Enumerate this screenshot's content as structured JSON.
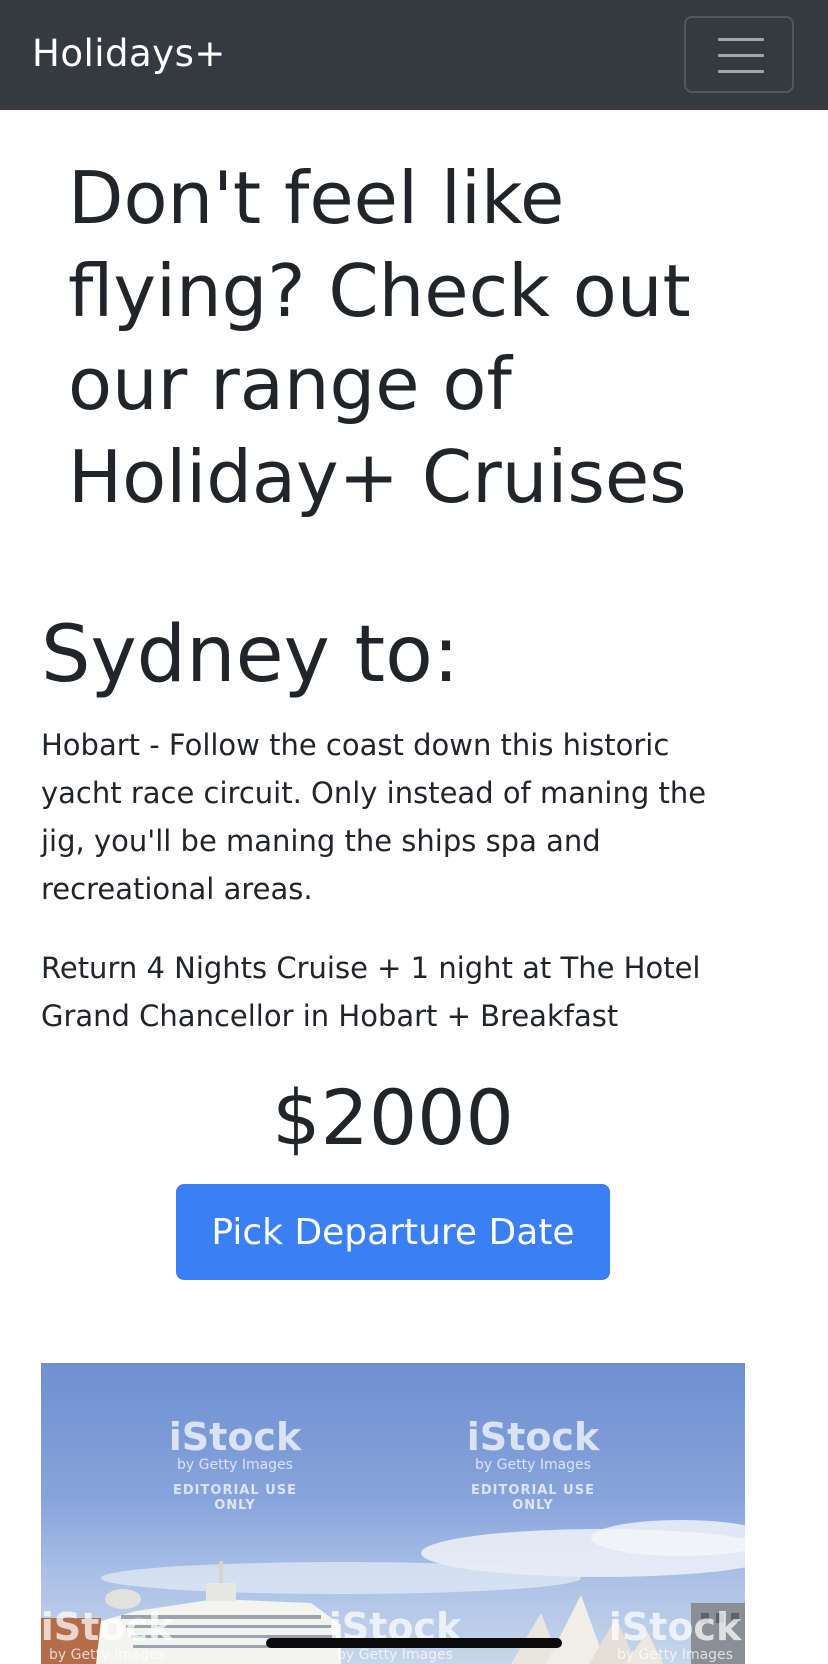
{
  "navbar": {
    "brand": "Holidays+",
    "toggle_icon": "hamburger-menu-icon"
  },
  "hero": {
    "heading": "Don't feel like flying? Check out our range of Holiday+ Cruises"
  },
  "cruise": {
    "title": "Sydney to:",
    "description": "Hobart - Follow the coast down this historic yacht race circuit. Only instead of maning the jig, you'll be maning the ships spa and recreational areas.",
    "package": "Return 4 Nights Cruise + 1 night at The Hotel Grand Chancellor in Hobart + Breakfast",
    "price": "$2000",
    "cta_label": "Pick Departure Date"
  },
  "photo": {
    "watermark_brand": "iStock",
    "watermark_sub": "by Getty Images",
    "watermark_note": "EDITORIAL USE ONLY"
  },
  "colors": {
    "navbar_bg": "#343a40",
    "cta_bg": "#3b7ff5",
    "text": "#212529"
  }
}
